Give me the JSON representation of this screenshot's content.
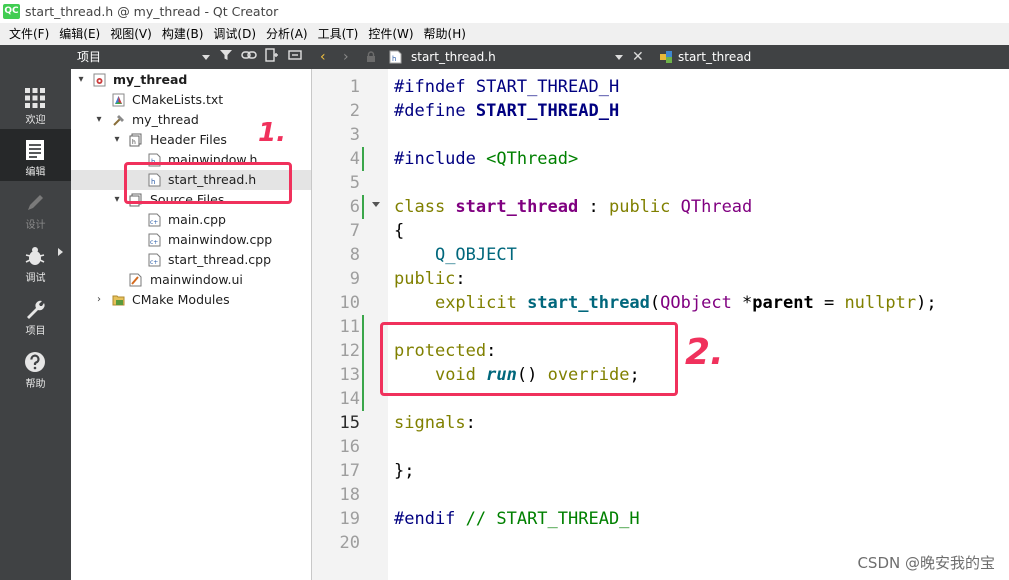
{
  "window": {
    "title": "start_thread.h @ my_thread - Qt Creator",
    "logo": "QC"
  },
  "menu": [
    "文件(F)",
    "编辑(E)",
    "视图(V)",
    "构建(B)",
    "调试(D)",
    "分析(A)",
    "工具(T)",
    "控件(W)",
    "帮助(H)"
  ],
  "modes": [
    {
      "label": "欢迎",
      "icon": "welcome-grid-icon",
      "active": false,
      "enabled": true
    },
    {
      "label": "编辑",
      "icon": "edit-document-icon",
      "active": true,
      "enabled": true
    },
    {
      "label": "设计",
      "icon": "design-pen-icon",
      "active": false,
      "enabled": false
    },
    {
      "label": "调试",
      "icon": "debug-bug-icon",
      "active": false,
      "enabled": true
    },
    {
      "label": "项目",
      "icon": "projects-wrench-icon",
      "active": false,
      "enabled": true
    },
    {
      "label": "帮助",
      "icon": "help-question-icon",
      "active": false,
      "enabled": true
    }
  ],
  "project_panel": {
    "view_selector": "项目",
    "tree": [
      {
        "label": "my_thread",
        "depth": 0,
        "expanded": true,
        "icon": "cmake-project-icon",
        "bold": true
      },
      {
        "label": "CMakeLists.txt",
        "depth": 1,
        "icon": "cmake-file-icon"
      },
      {
        "label": "my_thread",
        "depth": 1,
        "expanded": true,
        "icon": "build-target-icon"
      },
      {
        "label": "Header Files",
        "depth": 2,
        "expanded": true,
        "icon": "header-folder-icon"
      },
      {
        "label": "mainwindow.h",
        "depth": 3,
        "icon": "header-file-icon"
      },
      {
        "label": "start_thread.h",
        "depth": 3,
        "icon": "header-file-icon",
        "selected": true
      },
      {
        "label": "Source Files",
        "depth": 2,
        "expanded": true,
        "icon": "source-folder-icon"
      },
      {
        "label": "main.cpp",
        "depth": 3,
        "icon": "cpp-file-icon"
      },
      {
        "label": "mainwindow.cpp",
        "depth": 3,
        "icon": "cpp-file-icon"
      },
      {
        "label": "start_thread.cpp",
        "depth": 3,
        "icon": "cpp-file-icon"
      },
      {
        "label": "mainwindow.ui",
        "depth": 2,
        "icon": "ui-form-file-icon"
      },
      {
        "label": "CMake Modules",
        "depth": 1,
        "expanded": false,
        "icon": "cmake-modules-folder-icon"
      }
    ]
  },
  "editor": {
    "open_file": "start_thread.h",
    "symbol": "start_thread",
    "current_line": 15,
    "lines": [
      {
        "no": "1",
        "parts": [
          [
            "#ifndef ",
            "k-pre"
          ],
          [
            "START_THREAD_H",
            "k-macro"
          ]
        ]
      },
      {
        "no": "2",
        "parts": [
          [
            "#define ",
            "k-pre"
          ],
          [
            "START_THREAD_H",
            "k-macro k-bold"
          ]
        ]
      },
      {
        "no": "3",
        "parts": []
      },
      {
        "no": "4",
        "parts": [
          [
            "#include ",
            "k-pre"
          ],
          [
            "<QThread>",
            "k-inc"
          ]
        ]
      },
      {
        "no": "5",
        "parts": []
      },
      {
        "no": "6",
        "parts": [
          [
            "class ",
            "k-kw"
          ],
          [
            "start_thread",
            "k-type k-bold"
          ],
          [
            " : ",
            ""
          ],
          [
            "public ",
            "k-kw"
          ],
          [
            "QThread",
            "k-type"
          ]
        ]
      },
      {
        "no": "7",
        "parts": [
          [
            "{",
            ""
          ]
        ]
      },
      {
        "no": "8",
        "parts": [
          [
            "    ",
            ""
          ],
          [
            "Q_OBJECT",
            "k-qm"
          ]
        ]
      },
      {
        "no": "9",
        "parts": [
          [
            "public",
            "k-kw"
          ],
          [
            ":",
            ""
          ]
        ]
      },
      {
        "no": "10",
        "parts": [
          [
            "    ",
            ""
          ],
          [
            "explicit ",
            "k-kw"
          ],
          [
            "start_thread",
            "k-deffn"
          ],
          [
            "(",
            ""
          ],
          [
            "QObject ",
            "k-type"
          ],
          [
            "*",
            ""
          ],
          [
            "parent",
            "k-bold"
          ],
          [
            " = ",
            ""
          ],
          [
            "nullptr",
            "k-kw"
          ],
          [
            ");",
            ""
          ]
        ]
      },
      {
        "no": "11",
        "parts": []
      },
      {
        "no": "12",
        "parts": [
          [
            "protected",
            "k-kw"
          ],
          [
            ":",
            ""
          ]
        ]
      },
      {
        "no": "13",
        "parts": [
          [
            "    ",
            ""
          ],
          [
            "void ",
            "k-kw"
          ],
          [
            "run",
            "k-italic"
          ],
          [
            "() ",
            ""
          ],
          [
            "override",
            "k-kw"
          ],
          [
            ";",
            ""
          ]
        ]
      },
      {
        "no": "14",
        "parts": []
      },
      {
        "no": "15",
        "parts": [
          [
            "signals",
            "k-kw"
          ],
          [
            ":",
            ""
          ]
        ]
      },
      {
        "no": "16",
        "parts": []
      },
      {
        "no": "17",
        "parts": [
          [
            "};",
            ""
          ]
        ]
      },
      {
        "no": "18",
        "parts": []
      },
      {
        "no": "19",
        "parts": [
          [
            "#endif ",
            "k-pre"
          ],
          [
            "// START_THREAD_H",
            "k-com"
          ]
        ]
      },
      {
        "no": "20",
        "parts": []
      }
    ]
  },
  "annotations": {
    "one": "1.",
    "two": "2.",
    "color": "#f0315c"
  },
  "watermark": "CSDN @晚安我的宝"
}
